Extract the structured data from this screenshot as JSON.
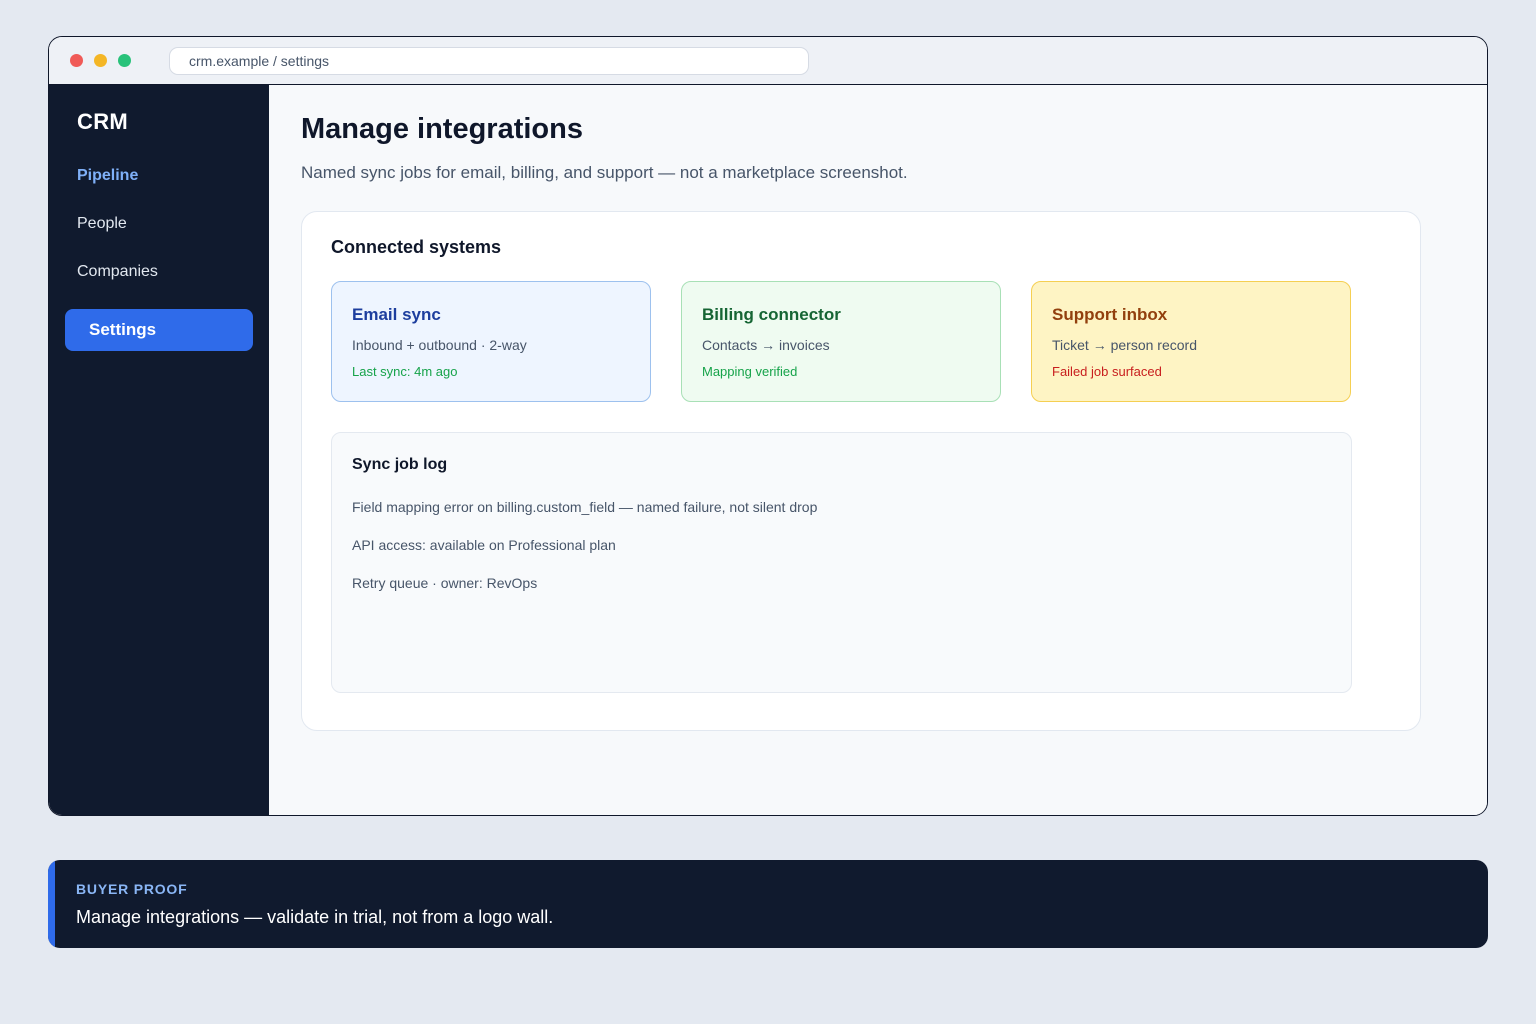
{
  "window": {
    "url": "crm.example / settings"
  },
  "sidebar": {
    "brand": "CRM",
    "items": [
      {
        "label": "Pipeline"
      },
      {
        "label": "People"
      },
      {
        "label": "Companies"
      },
      {
        "label": "Settings"
      }
    ]
  },
  "main": {
    "title": "Manage integrations",
    "subtitle": "Named sync jobs for email, billing, and support — not a marketplace screenshot.",
    "panel": {
      "title": "Connected systems",
      "cards": [
        {
          "title": "Email sync",
          "desc": "Inbound + outbound · 2-way",
          "status": "Last sync: 4m ago"
        },
        {
          "title": "Billing connector",
          "desc": "Contacts → invoices",
          "status": "Mapping verified"
        },
        {
          "title": "Support inbox",
          "desc": "Ticket → person record",
          "status": "Failed job surfaced"
        }
      ],
      "log": {
        "title": "Sync job log",
        "entries": [
          "Field mapping error on billing.custom_field — named failure, not silent drop",
          "API access: available on Professional plan",
          "Retry queue · owner: RevOps"
        ]
      }
    }
  },
  "banner": {
    "kicker": "BUYER PROOF",
    "text": "Manage integrations — validate in trial, not from a logo wall."
  },
  "colors": {
    "sidebar_bg": "#101a2e",
    "accent": "#2f6bea",
    "success": "#16a34a",
    "error": "#c81e1e"
  }
}
